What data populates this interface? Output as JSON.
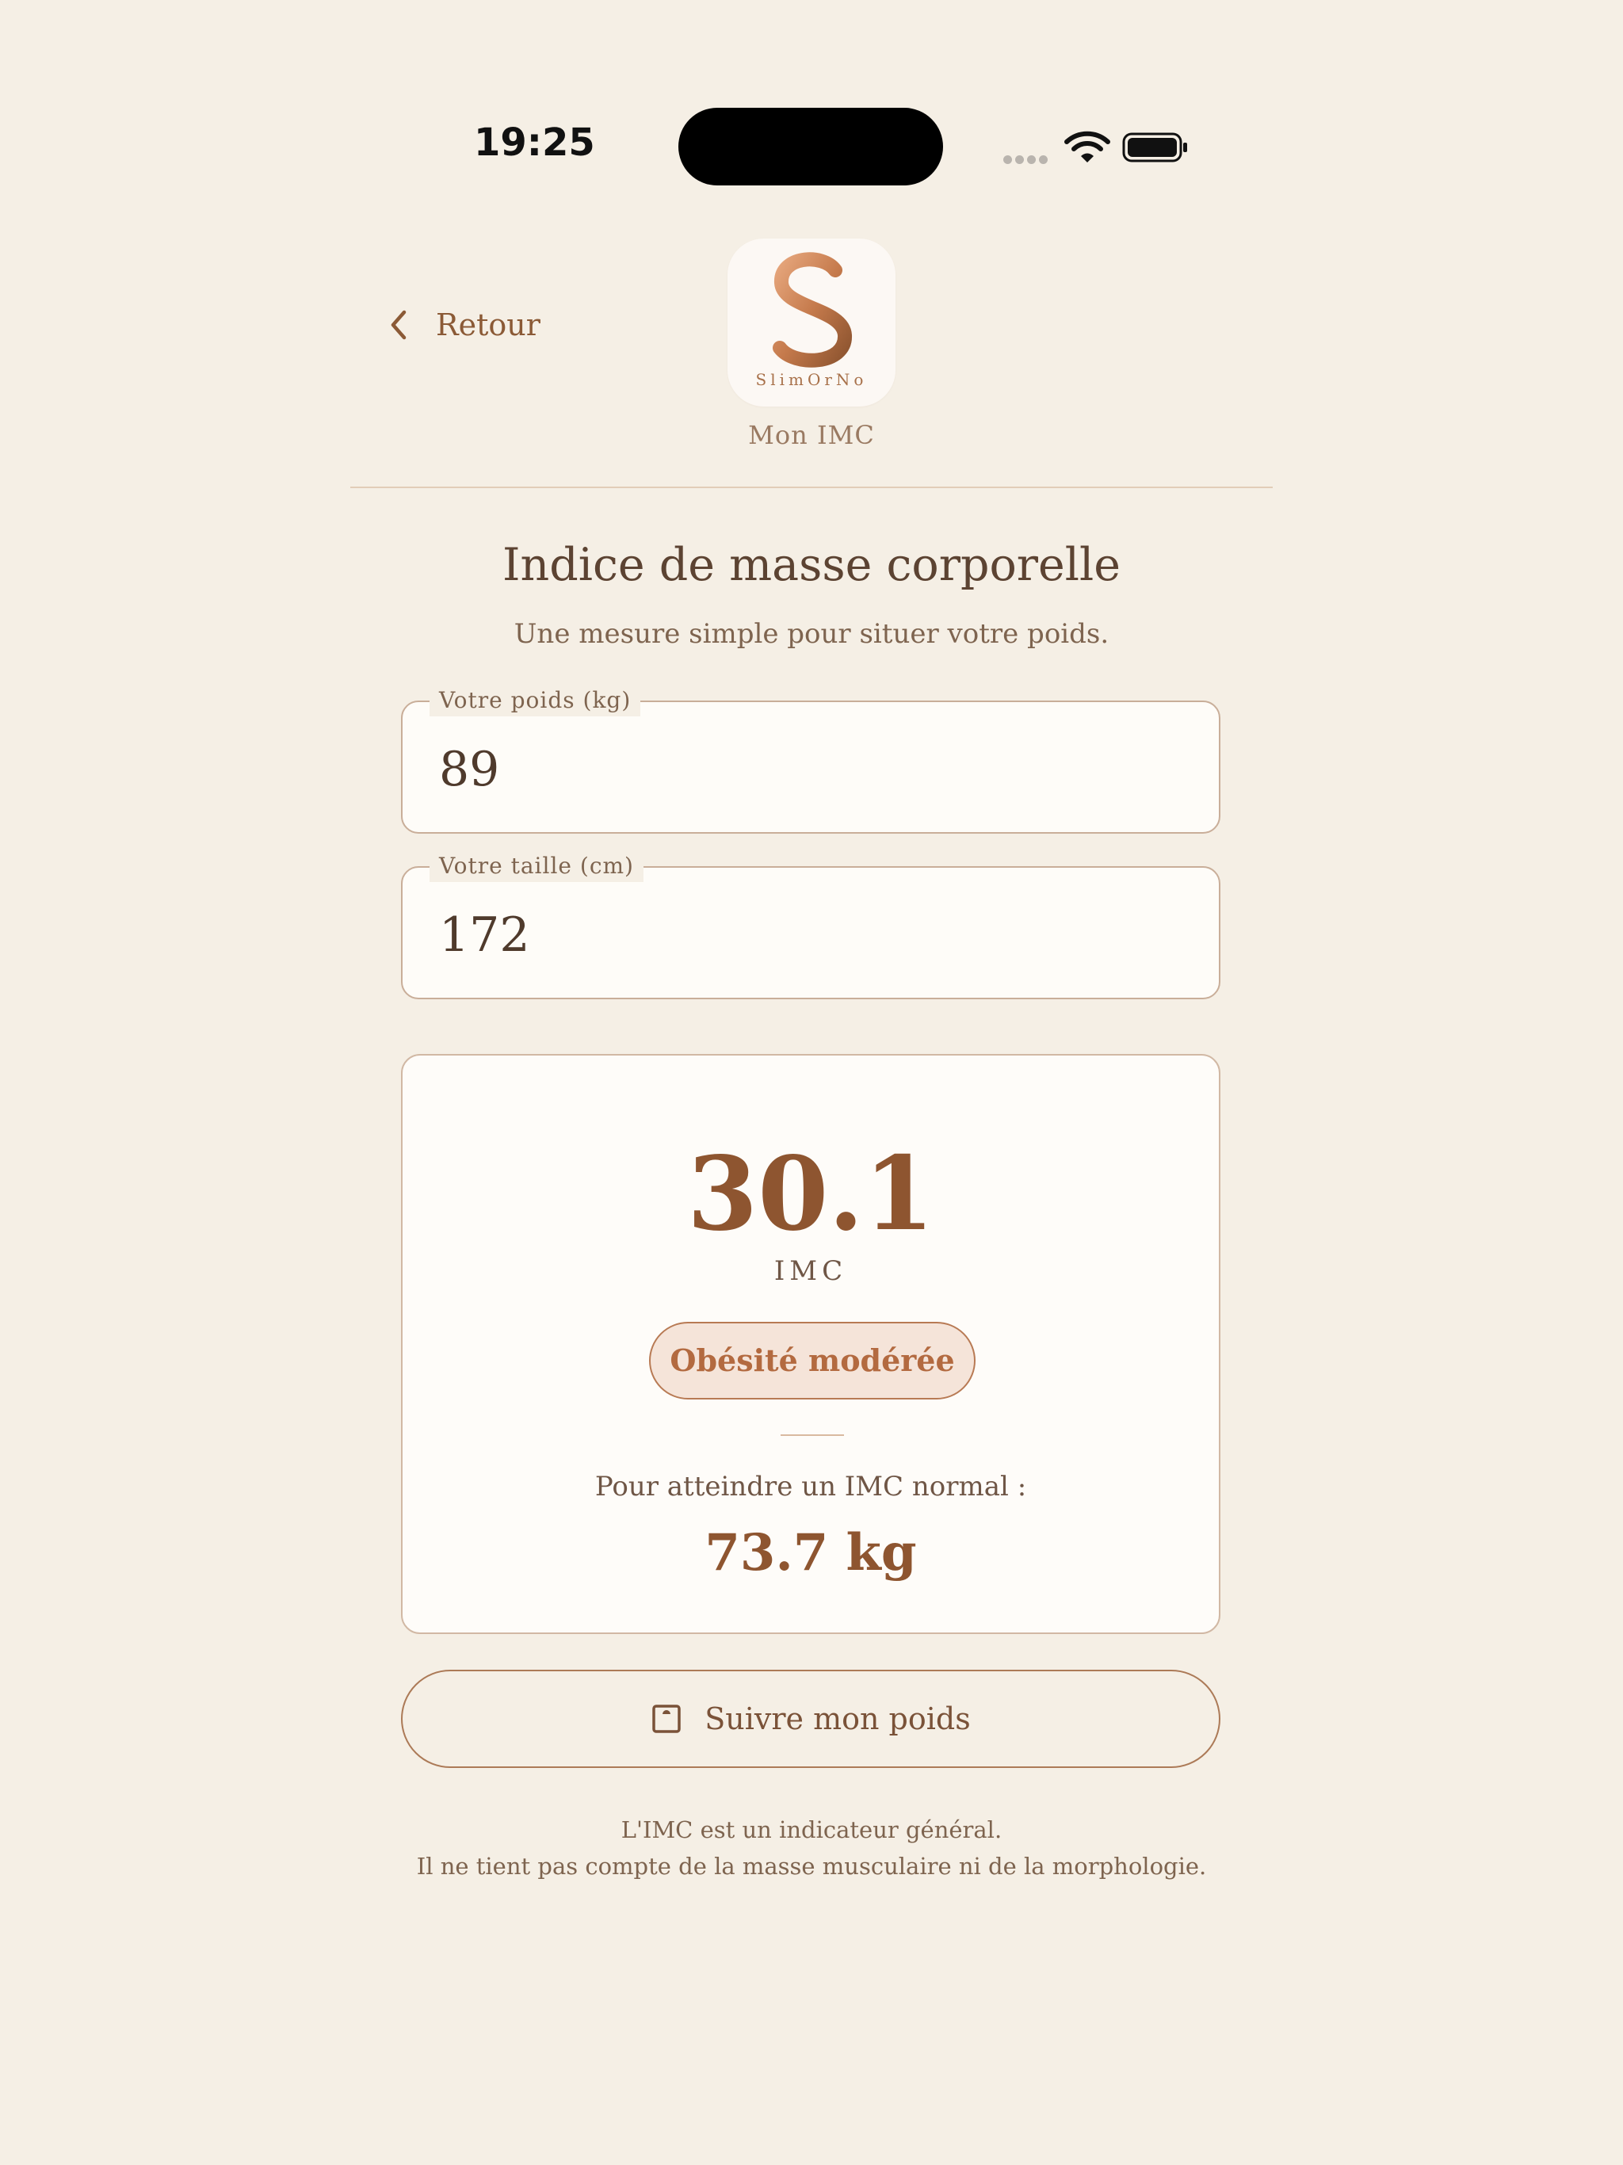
{
  "status_bar": {
    "time": "19:25",
    "icons": [
      "cellular-signal-icon",
      "wifi-icon",
      "battery-icon"
    ]
  },
  "header": {
    "back_label": "Retour",
    "logo_wordmark": "SlimOrNo",
    "subtitle": "Mon IMC"
  },
  "main": {
    "title": "Indice de masse corporelle",
    "subtitle": "Une mesure simple pour situer votre poids."
  },
  "inputs": {
    "weight": {
      "label": "Votre poids (kg)",
      "value": "89"
    },
    "height": {
      "label": "Votre taille (cm)",
      "value": "172"
    }
  },
  "result": {
    "bmi_value": "30.1",
    "bmi_label": "IMC",
    "category": "Obésité modérée",
    "target_label": "Pour atteindre un IMC normal :",
    "target_value": "73.7 kg"
  },
  "actions": {
    "track_label": "Suivre mon poids",
    "track_icon": "scale-icon"
  },
  "disclaimer": {
    "line1": "L'IMC est un indicateur général.",
    "line2": "Il ne tient pas compte de la masse musculaire ni de la morphologie."
  },
  "colors": {
    "background": "#F5EFE5",
    "accent": "#8E5530",
    "badge_background": "#F5E4D9",
    "badge_text": "#B36A40",
    "border": "#C9AE99"
  }
}
